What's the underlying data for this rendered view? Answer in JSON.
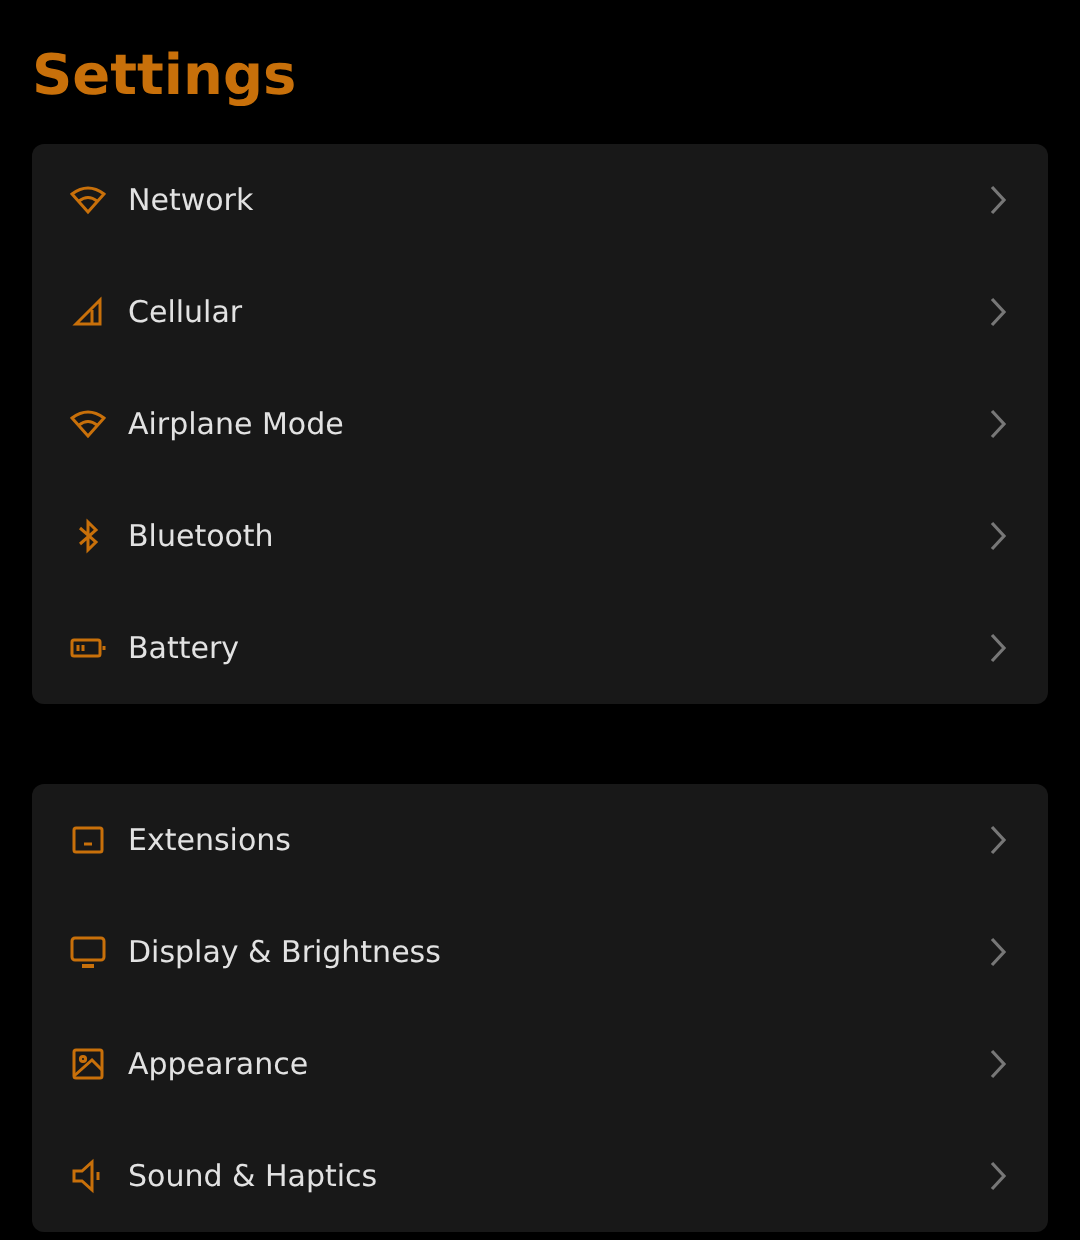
{
  "title": "Settings",
  "groups": [
    {
      "items": [
        {
          "label": "Network"
        },
        {
          "label": "Cellular"
        },
        {
          "label": "Airplane Mode"
        },
        {
          "label": "Bluetooth"
        },
        {
          "label": "Battery"
        }
      ]
    },
    {
      "items": [
        {
          "label": "Extensions"
        },
        {
          "label": "Display & Brightness"
        },
        {
          "label": "Appearance"
        },
        {
          "label": "Sound & Haptics"
        }
      ]
    }
  ]
}
